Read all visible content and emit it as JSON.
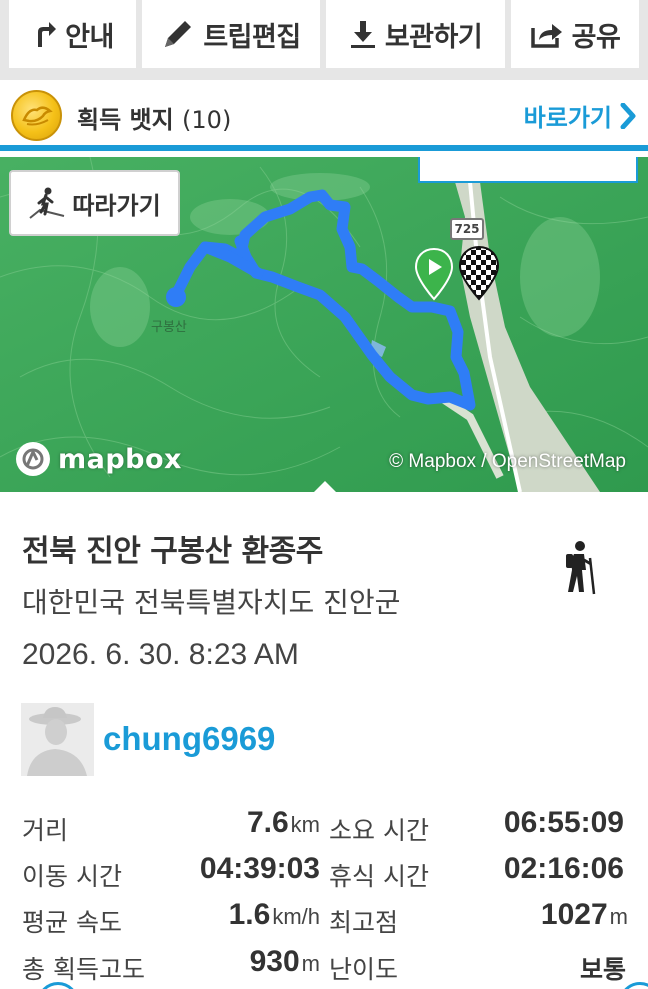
{
  "toolbar": {
    "guide": "안내",
    "edit": "트립편집",
    "save": "보관하기",
    "share": "공유"
  },
  "badges": {
    "label": "획득 뱃지",
    "count": "(10)",
    "goto": "바로가기"
  },
  "map": {
    "follow": "따라가기",
    "peak": "구봉산",
    "road": "725",
    "logo": "mapbox",
    "attribution": "© Mapbox / OpenStreetMap"
  },
  "trip": {
    "title": "전북 진안 구봉산 환종주",
    "location": "대한민국 전북특별자치도 진안군",
    "datetime": "2026. 6. 30. 8:23 AM",
    "activity_icon": "hiker-icon"
  },
  "user": {
    "name": "chung6969"
  },
  "stats": [
    {
      "label": "거리",
      "value": "7.6",
      "unit": "km"
    },
    {
      "label": "소요 시간",
      "value": "06:55:09",
      "unit": ""
    },
    {
      "label": "이동 시간",
      "value": "04:39:03",
      "unit": ""
    },
    {
      "label": "휴식 시간",
      "value": "02:16:06",
      "unit": ""
    },
    {
      "label": "평균 속도",
      "value": "1.6",
      "unit": "km/h"
    },
    {
      "label": "최고점",
      "value": "1027",
      "unit": "m"
    },
    {
      "label": "총 획득고도",
      "value": "930",
      "unit": "m"
    },
    {
      "label": "난이도",
      "value": "보통",
      "unit": ""
    }
  ],
  "colors": {
    "accent": "#1a9bd7",
    "track": "#2f7df6",
    "start_marker": "#3cb44b"
  }
}
